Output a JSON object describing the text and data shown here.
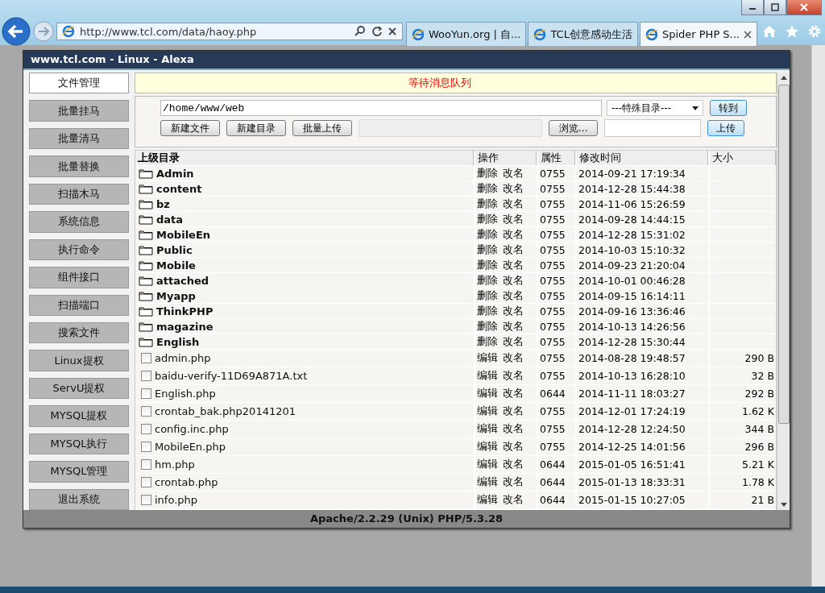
{
  "browser": {
    "address": "http://www.tcl.com/data/haoy.php",
    "tabs": [
      {
        "label": "WooYun.org | 自...",
        "selected": false
      },
      {
        "label": "TCL创意感动生活",
        "selected": false
      },
      {
        "label": "Spider PHP S...",
        "selected": true
      }
    ]
  },
  "panel": {
    "title": "www.tcl.com - Linux - Alexa",
    "sidebar": [
      {
        "label": "文件管理",
        "selected": true
      },
      {
        "label": "批量挂马",
        "selected": false
      },
      {
        "label": "批量清马",
        "selected": false
      },
      {
        "label": "批量替换",
        "selected": false
      },
      {
        "label": "扫描木马",
        "selected": false
      },
      {
        "label": "系统信息",
        "selected": false
      },
      {
        "label": "执行命令",
        "selected": false
      },
      {
        "label": "组件接口",
        "selected": false
      },
      {
        "label": "扫描端口",
        "selected": false
      },
      {
        "label": "搜索文件",
        "selected": false
      },
      {
        "label": "Linux提权",
        "selected": false
      },
      {
        "label": "ServU提权",
        "selected": false
      },
      {
        "label": "MYSQL提权",
        "selected": false
      },
      {
        "label": "MYSQL执行",
        "selected": false
      },
      {
        "label": "MYSQL管理",
        "selected": false
      },
      {
        "label": "退出系统",
        "selected": false
      }
    ],
    "message": "等待消息队列",
    "path": "/home/www/web",
    "special_dir": "---特殊目录---",
    "goto_button": "转到",
    "buttons": [
      "新建文件",
      "新建目录",
      "批量上传"
    ],
    "browse_button": "浏览...",
    "upload_button": "上传",
    "columns": [
      "上级目录",
      "操作",
      "属性",
      "修改时间",
      "大小"
    ],
    "rows": [
      {
        "kind": "folder",
        "name": "Admin",
        "actions": [
          "删除",
          "改名"
        ],
        "perm": "0755",
        "time": "2014-09-21 17:19:34"
      },
      {
        "kind": "folder",
        "name": "content",
        "actions": [
          "删除",
          "改名"
        ],
        "perm": "0755",
        "time": "2014-12-28 15:44:38"
      },
      {
        "kind": "folder",
        "name": "bz",
        "actions": [
          "删除",
          "改名"
        ],
        "perm": "0755",
        "time": "2014-11-06 15:26:59"
      },
      {
        "kind": "folder",
        "name": "data",
        "actions": [
          "删除",
          "改名"
        ],
        "perm": "0755",
        "time": "2014-09-28 14:44:15"
      },
      {
        "kind": "folder",
        "name": "MobileEn",
        "actions": [
          "删除",
          "改名"
        ],
        "perm": "0755",
        "time": "2014-12-28 15:31:02"
      },
      {
        "kind": "folder",
        "name": "Public",
        "actions": [
          "删除",
          "改名"
        ],
        "perm": "0755",
        "time": "2014-10-03 15:10:32"
      },
      {
        "kind": "folder",
        "name": "Mobile",
        "actions": [
          "删除",
          "改名"
        ],
        "perm": "0755",
        "time": "2014-09-23 21:20:04"
      },
      {
        "kind": "folder",
        "name": "attached",
        "actions": [
          "删除",
          "改名"
        ],
        "perm": "0755",
        "time": "2014-10-01 00:46:28"
      },
      {
        "kind": "folder",
        "name": "Myapp",
        "actions": [
          "删除",
          "改名"
        ],
        "perm": "0755",
        "time": "2014-09-15 16:14:11"
      },
      {
        "kind": "folder",
        "name": "ThinkPHP",
        "actions": [
          "删除",
          "改名"
        ],
        "perm": "0755",
        "time": "2014-09-16 13:36:46"
      },
      {
        "kind": "folder",
        "name": "magazine",
        "actions": [
          "删除",
          "改名"
        ],
        "perm": "0755",
        "time": "2014-10-13 14:26:56"
      },
      {
        "kind": "folder",
        "name": "English",
        "actions": [
          "删除",
          "改名"
        ],
        "perm": "0755",
        "time": "2014-12-28 15:30:44"
      },
      {
        "kind": "file",
        "checked": false,
        "name": "admin.php",
        "actions": [
          "编辑",
          "改名"
        ],
        "perm": "0755",
        "time": "2014-08-28 19:48:57",
        "size": "290 B"
      },
      {
        "kind": "file",
        "checked": false,
        "name": "baidu-verify-11D69A871A.txt",
        "actions": [
          "编辑",
          "改名"
        ],
        "perm": "0755",
        "time": "2014-10-13 16:28:10",
        "size": "32 B"
      },
      {
        "kind": "file",
        "checked": false,
        "name": "English.php",
        "actions": [
          "编辑",
          "改名"
        ],
        "perm": "0644",
        "time": "2014-11-11 18:03:27",
        "size": "292 B"
      },
      {
        "kind": "file",
        "checked": false,
        "name": "crontab_bak.php20141201",
        "actions": [
          "编辑",
          "改名"
        ],
        "perm": "0755",
        "time": "2014-12-01 17:24:19",
        "size": "1.62 K"
      },
      {
        "kind": "file",
        "checked": false,
        "name": "config.inc.php",
        "actions": [
          "编辑",
          "改名"
        ],
        "perm": "0755",
        "time": "2014-12-28 12:24:50",
        "size": "344 B"
      },
      {
        "kind": "file",
        "checked": false,
        "name": "MobileEn.php",
        "actions": [
          "编辑",
          "改名"
        ],
        "perm": "0755",
        "time": "2014-12-25 14:01:56",
        "size": "296 B"
      },
      {
        "kind": "file",
        "checked": false,
        "name": "hm.php",
        "actions": [
          "编辑",
          "改名"
        ],
        "perm": "0644",
        "time": "2015-01-05 16:51:41",
        "size": "5.21 K"
      },
      {
        "kind": "file",
        "checked": false,
        "name": "crontab.php",
        "actions": [
          "编辑",
          "改名"
        ],
        "perm": "0644",
        "time": "2015-01-13 18:33:31",
        "size": "1.78 K"
      },
      {
        "kind": "file",
        "checked": false,
        "name": "info.php",
        "actions": [
          "编辑",
          "改名"
        ],
        "perm": "0644",
        "time": "2015-01-15 10:27:05",
        "size": "21 B"
      }
    ],
    "footer": "Apache/2.2.29 (Unix) PHP/5.3.28"
  }
}
